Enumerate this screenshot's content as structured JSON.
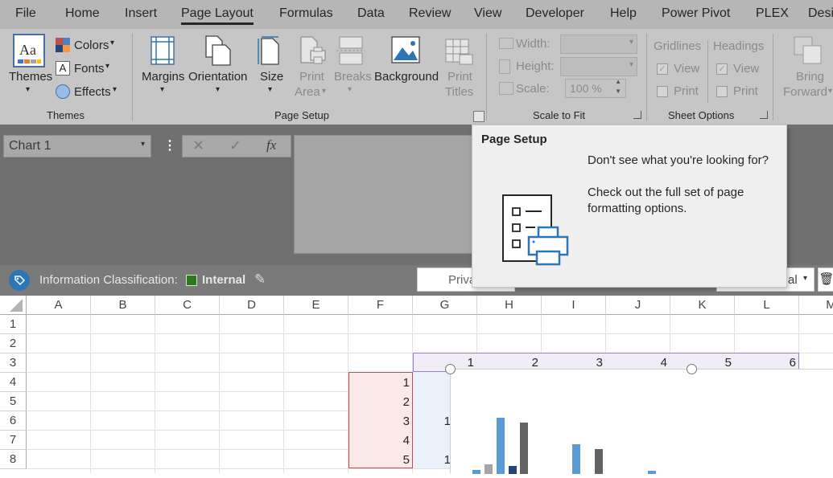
{
  "menu": {
    "tabs": [
      "File",
      "Home",
      "Insert",
      "Page Layout",
      "Formulas",
      "Data",
      "Review",
      "View",
      "Developer",
      "Help",
      "Power Pivot",
      "PLEX",
      "Desi"
    ]
  },
  "ribbon": {
    "themes": {
      "themes_label": "Themes",
      "colors_label": "Colors",
      "fonts_label": "Fonts",
      "effects_label": "Effects",
      "group_label": "Themes"
    },
    "page_setup": {
      "margins": "Margins",
      "orientation": "Orientation",
      "size": "Size",
      "print_area_1": "Print",
      "print_area_2": "Area",
      "breaks": "Breaks",
      "background": "Background",
      "print_titles_1": "Print",
      "print_titles_2": "Titles",
      "group_label": "Page Setup"
    },
    "scale_to_fit": {
      "width_label": "Width:",
      "height_label": "Height:",
      "scale_label": "Scale:",
      "scale_value": "100 %",
      "group_label": "Scale to Fit"
    },
    "sheet_options": {
      "gridlines": "Gridlines",
      "headings": "Headings",
      "view": "View",
      "print": "Print",
      "group_label": "Sheet Options"
    },
    "arrange": {
      "bring_1": "Bring",
      "bring_2": "Forward"
    }
  },
  "formula_bar": {
    "name_box": "Chart 1",
    "cancel_icon": "✕",
    "enter_icon": "✓",
    "fx": "fx"
  },
  "info_bar": {
    "label": "Information Classification:",
    "value": "Internal",
    "field1": "Priva",
    "field2": "al"
  },
  "popup": {
    "title": "Page Setup",
    "line1": "Don't see what you're looking for?",
    "line2": "Check out the full set of page",
    "line3": "formatting options."
  },
  "sheet": {
    "columns": [
      "A",
      "B",
      "C",
      "D",
      "E",
      "F",
      "G",
      "H",
      "I",
      "J",
      "K",
      "L",
      "M"
    ],
    "rows": [
      "1",
      "2",
      "3",
      "4",
      "5",
      "6",
      "7",
      "8"
    ],
    "col_range_values": [
      "1",
      "2",
      "3",
      "4",
      "5",
      "6"
    ],
    "row_range_values": [
      "1",
      "2",
      "3",
      "4",
      "5"
    ],
    "g_partial": [
      "1",
      "1"
    ]
  },
  "chart_data": {
    "type": "bar",
    "series": [
      {
        "color": "#5b9bd5"
      },
      {
        "color": "#a5a5a5"
      },
      {
        "color": "#264478"
      },
      {
        "color": "#636363"
      }
    ]
  }
}
